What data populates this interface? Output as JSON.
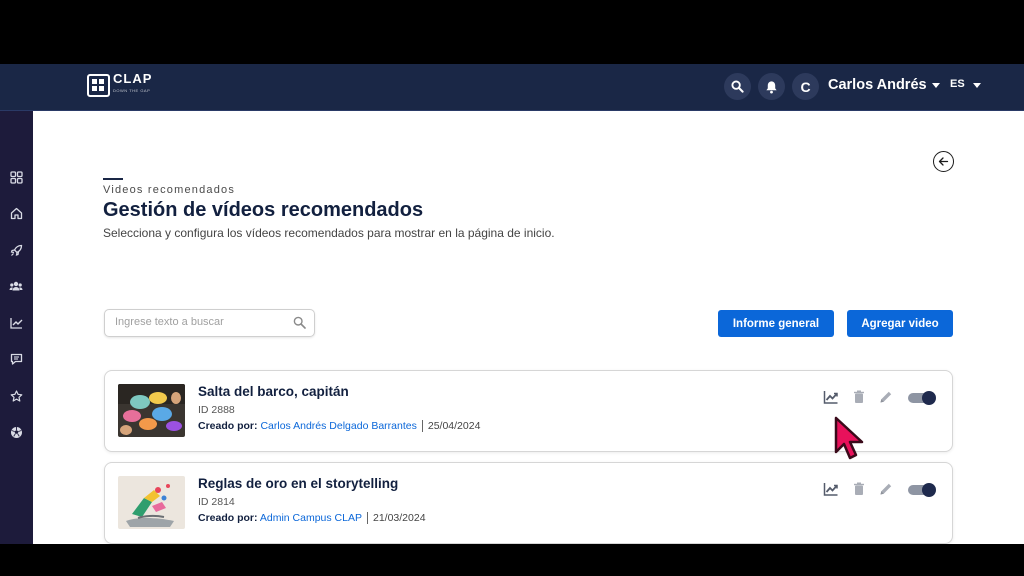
{
  "header": {
    "logo_text": "CLAP",
    "logo_sub": "DOWN THE GAP",
    "avatar_initial": "C",
    "user_name": "Carlos Andrés",
    "language": "ES"
  },
  "sidebar": {
    "items": [
      "grid-icon",
      "home-icon",
      "rocket-icon",
      "users-icon",
      "chart-icon",
      "chat-icon",
      "star-icon",
      "soccer-ball-icon"
    ]
  },
  "page": {
    "breadcrumb": "Videos recomendados",
    "title": "Gestión de vídeos recomendados",
    "subtitle": "Selecciona y configura los vídeos recomendados para mostrar en la página de inicio."
  },
  "search": {
    "placeholder": "Ingrese texto a buscar"
  },
  "buttons": {
    "report": "Informe general",
    "add": "Agregar video"
  },
  "videos": [
    {
      "title": "Salta del barco, capitán",
      "id": "ID 2888",
      "created_by_label": "Creado por:",
      "author": "Carlos Andrés Delgado Barrantes",
      "date": "25/04/2024",
      "active": true
    },
    {
      "title": "Reglas de oro en el storytelling",
      "id": "ID 2814",
      "created_by_label": "Creado por:",
      "author": "Admin Campus CLAP",
      "date": "21/03/2024",
      "active": true
    }
  ],
  "colors": {
    "topbar": "#1a2746",
    "sidebar": "#1d1b3b",
    "primary": "#0b67d9",
    "title": "#12203f",
    "cursor": "#e8115b"
  }
}
